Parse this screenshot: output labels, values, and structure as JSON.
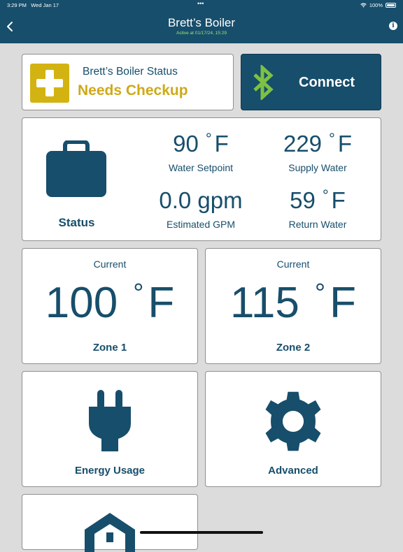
{
  "statusbar": {
    "time": "3:29 PM",
    "date": "Wed Jan 17",
    "battery": "100%"
  },
  "header": {
    "title": "Brett’s Boiler",
    "subtitle": "Active at 01/17/24, 15:29",
    "info": "i"
  },
  "status_card": {
    "label": "Brett’s Boiler Status",
    "value": "Needs Checkup"
  },
  "connect": {
    "label": "Connect"
  },
  "metrics": {
    "title": "Status",
    "water_setpoint": {
      "value": "90",
      "unit": "F",
      "label": "Water Setpoint"
    },
    "supply_water": {
      "value": "229",
      "unit": "F",
      "label": "Supply Water"
    },
    "estimated_gpm": {
      "value": "0.0 gpm",
      "label": "Estimated GPM"
    },
    "return_water": {
      "value": "59",
      "unit": "F",
      "label": "Return Water"
    }
  },
  "zones": [
    {
      "top": "Current",
      "value": "100",
      "unit": "F",
      "name": "Zone 1"
    },
    {
      "top": "Current",
      "value": "115",
      "unit": "F",
      "name": "Zone 2"
    }
  ],
  "tiles": {
    "energy": "Energy Usage",
    "advanced": "Advanced"
  },
  "colors": {
    "primary": "#174e6b",
    "warning": "#cfa918",
    "bluetooth": "#7dc143",
    "active": "#9fe77a",
    "background": "#dcdcdc"
  }
}
